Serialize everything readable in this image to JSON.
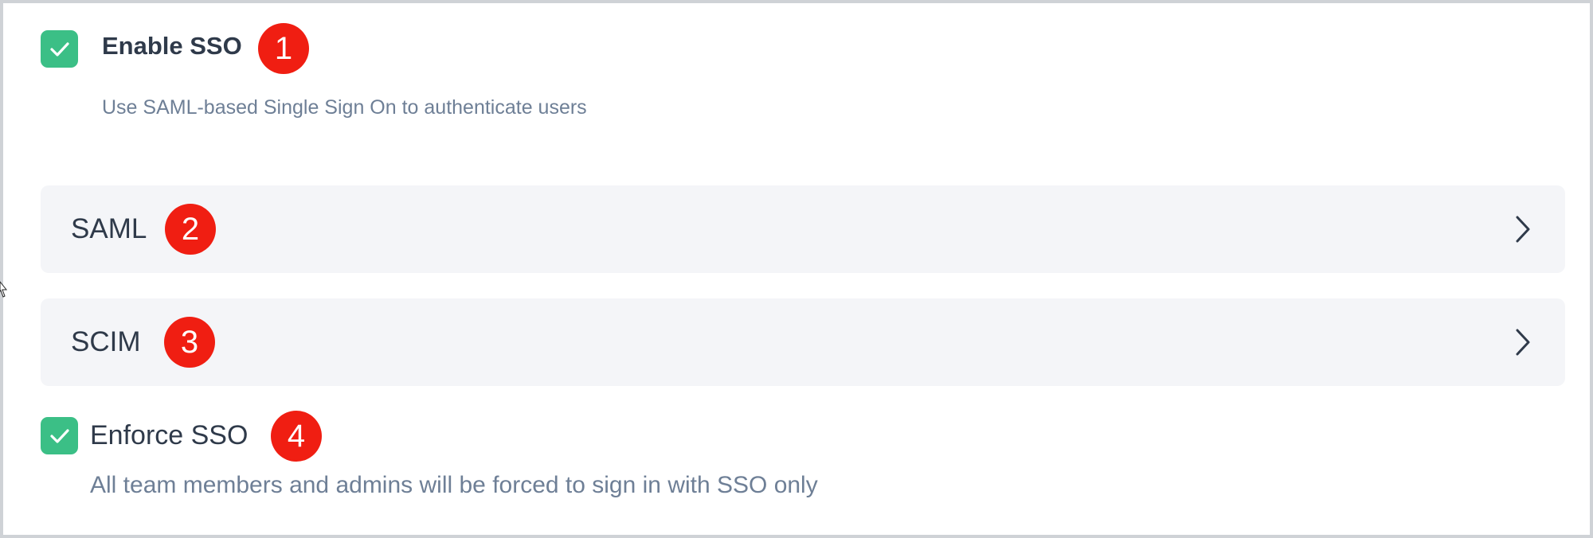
{
  "colors": {
    "checkbox_green": "#3bbf86",
    "badge_red": "#f01e12",
    "row_bg": "#f4f5f8",
    "text_dark": "#2f3a4a",
    "text_muted": "#6e7f96"
  },
  "enable_sso": {
    "checked": true,
    "label": "Enable SSO",
    "description": "Use SAML-based Single Sign On to authenticate users",
    "badge": "1"
  },
  "rows": [
    {
      "label": "SAML",
      "badge": "2",
      "icon": "chevron-right-icon"
    },
    {
      "label": "SCIM",
      "badge": "3",
      "icon": "chevron-right-icon"
    }
  ],
  "enforce_sso": {
    "checked": true,
    "label": "Enforce SSO",
    "description": "All team members and admins will be forced to sign in with SSO only",
    "badge": "4"
  }
}
